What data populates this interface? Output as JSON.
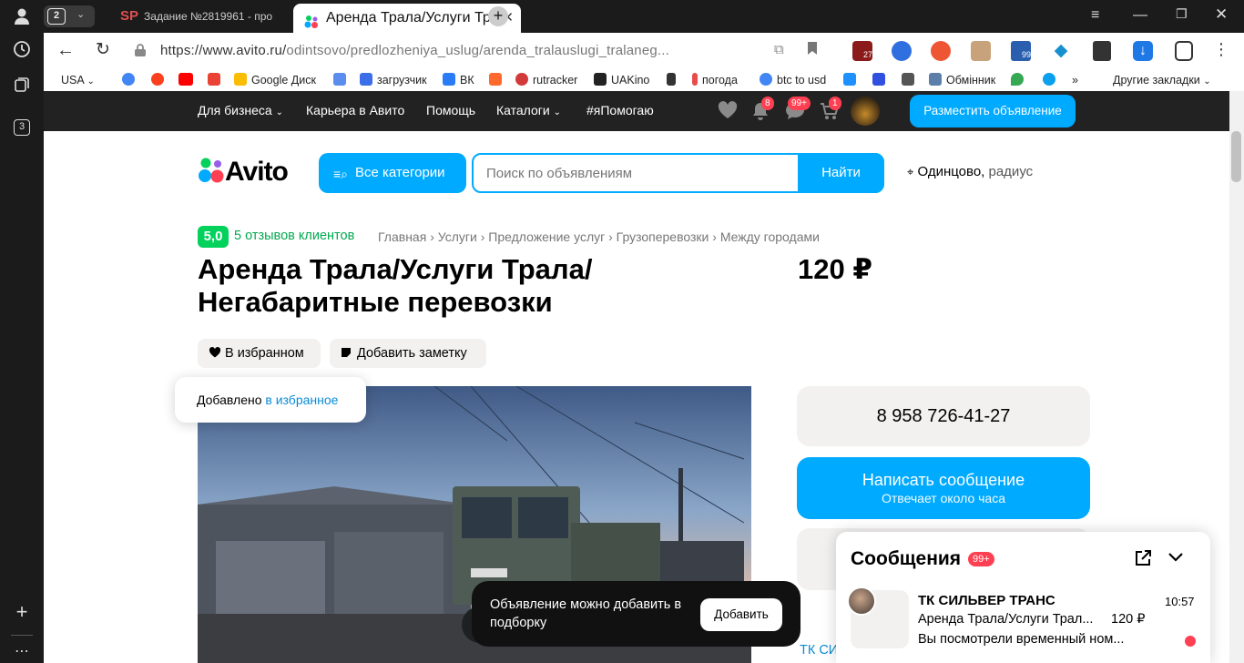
{
  "browser": {
    "tab_count": "2",
    "tabs": [
      {
        "label": "Задание №2819961 - про",
        "icon": "SP"
      },
      {
        "label": "Аренда Трала/Услуги Тр"
      }
    ],
    "rail_counter": "3",
    "url_host": "https://www.avito.ru/",
    "url_path": "odintsovo/predlozheniya_uslug/arenda_tralauslugi_tralaneg...",
    "ext_badges": [
      "27",
      "99"
    ]
  },
  "bookmarks": [
    {
      "label": "USA",
      "color": "#ffffff"
    },
    {
      "label": "",
      "color": "#4285f4"
    },
    {
      "label": "",
      "color": "#fc3f1d"
    },
    {
      "label": "",
      "color": "#ff0000"
    },
    {
      "label": "",
      "color": "#ea4335"
    },
    {
      "label": "Google Диск",
      "color": "#fbbc04"
    },
    {
      "label": "",
      "color": "#5b8def"
    },
    {
      "label": "загрузчик",
      "color": "#3b6ee8"
    },
    {
      "label": "ВК",
      "color": "#2a7cf6"
    },
    {
      "label": "",
      "color": "#ff6a2c"
    },
    {
      "label": "rutracker",
      "color": "#d23a3a"
    },
    {
      "label": "UAKino",
      "color": "#222222"
    },
    {
      "label": "",
      "color": "#333333"
    },
    {
      "label": "погода",
      "color": "#e94a4a"
    },
    {
      "label": "btc to usd",
      "color": "#4285f4"
    },
    {
      "label": "",
      "color": "#1e90ff"
    },
    {
      "label": "",
      "color": "#3050e0"
    },
    {
      "label": "",
      "color": "#555555"
    },
    {
      "label": "Обмінник",
      "color": "#5b7fa8"
    },
    {
      "label": "",
      "color": "#34a853"
    },
    {
      "label": "",
      "color": "#0aa0ee"
    }
  ],
  "bookmarks_more": "»",
  "bookmarks_other": "Другие закладки",
  "avito_header": {
    "nav": [
      "Для бизнеса",
      "Карьера в Авито",
      "Помощь",
      "Каталоги",
      "#яПомогаю"
    ],
    "notif_badge": "8",
    "messages_badge": "99+",
    "cart_badge": "1",
    "post_button": "Разместить объявление"
  },
  "search": {
    "logo": "Avito",
    "all_categories": "Все категории",
    "placeholder": "Поиск по объявлениям",
    "button": "Найти",
    "location": "Одинцово,",
    "radius": "радиус"
  },
  "listing": {
    "rating": "5,0",
    "reviews": "5 отзывов клиентов",
    "breadcrumbs": [
      "Главная",
      "Услуги",
      "Предложение услуг",
      "Грузоперевозки",
      "Между городами"
    ],
    "title_line1": "Аренда Трала/Услуги Трала/",
    "title_line2": "Негабаритные перевозки",
    "price": "120 ₽",
    "favorite_label": "В избранном",
    "note_label": "Добавить заметку",
    "toast_prefix": "Добавлено",
    "toast_link": "в избранное",
    "phone": "8 958 726-41-27",
    "write_title": "Написать сообщение",
    "write_sub": "Отвечает около часа",
    "seller_link": "ТК СИ"
  },
  "addsel": {
    "text": "Объявление можно добавить в подборку",
    "button": "Добавить"
  },
  "messages": {
    "title": "Сообщения",
    "badge": "99+",
    "item": {
      "sender": "ТК СИЛЬВЕР ТРАНС",
      "time": "10:57",
      "subject": "Аренда Трала/Услуги Трал...",
      "price": "120 ₽",
      "preview": "Вы посмотрели временный ном..."
    }
  },
  "colors": {
    "avito_blue": "#00aaff",
    "green": "#02d15c",
    "dark_header": "#222222",
    "badge_red": "#ff4053"
  }
}
